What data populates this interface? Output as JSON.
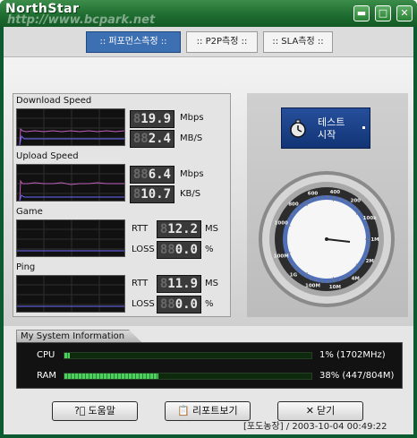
{
  "window": {
    "title": "NorthStar",
    "watermark": "http://www.bcpark.net",
    "minimize_label": "▬",
    "maximize_label": "□",
    "close_label": "✕"
  },
  "tabs": [
    {
      "label": ":: 퍼포먼스측정 ::",
      "active": true
    },
    {
      "label": ":: P2P측정 ::",
      "active": false
    },
    {
      "label": ":: SLA측정 ::",
      "active": false
    }
  ],
  "download": {
    "label": "Download Speed",
    "mbps_ghost": "8",
    "mbps_value": "19.9",
    "mbps_unit": "Mbps",
    "mbs_ghost": "88",
    "mbs_value": "2.4",
    "mbs_unit": "MB/S"
  },
  "upload": {
    "label": "Upload Speed",
    "mbps_ghost": "88",
    "mbps_value": "6.4",
    "mbps_unit": "Mbps",
    "kbs_ghost": "8",
    "kbs_value": "10.7",
    "kbs_unit": "KB/S"
  },
  "game": {
    "label": "Game",
    "rtt_label": "RTT",
    "rtt_ghost": "8",
    "rtt_value": "12.2",
    "rtt_unit": "MS",
    "loss_label": "LOSS",
    "loss_ghost": "88",
    "loss_value": "0.0",
    "loss_unit": "%"
  },
  "ping": {
    "label": "Ping",
    "rtt_label": "RTT",
    "rtt_ghost": "8",
    "rtt_value": "11.9",
    "rtt_unit": "MS",
    "loss_label": "LOSS",
    "loss_ghost": "88",
    "loss_value": "0.0",
    "loss_unit": "%"
  },
  "start_button": {
    "line1": "테스트",
    "line2": "시작"
  },
  "gauge": {
    "ticks": [
      "1000",
      "800",
      "600",
      "400",
      "200",
      "100k",
      "1M",
      "2M",
      "4M",
      "10M",
      "100M",
      "1G",
      "100M"
    ]
  },
  "system": {
    "tab_label": "My System Information",
    "cpu_label": "CPU",
    "cpu_value": "1% (1702MHz)",
    "cpu_fill": 0.01,
    "ram_label": "RAM",
    "ram_value": "38% (447/804M)",
    "ram_fill": 0.38
  },
  "buttons": {
    "help": "도움말",
    "report": "리포트보기",
    "close": "닫기"
  },
  "status": "[포도농장] / 2003-10-04 00:49:22",
  "colors": {
    "title_green": "#1f6d30",
    "tab_active": "#3d6fb3",
    "start_blue": "#1a3f86",
    "bar_green": "#4dd25d"
  }
}
